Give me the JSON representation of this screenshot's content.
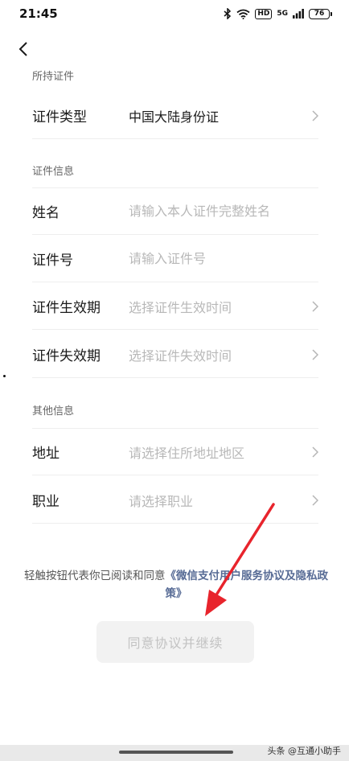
{
  "status_bar": {
    "time": "21:45",
    "network": "5G",
    "hd": "HD",
    "battery": "76"
  },
  "sections": {
    "held_id": "所持证件",
    "id_info": "证件信息",
    "other_info": "其他信息"
  },
  "rows": {
    "id_type": {
      "label": "证件类型",
      "value": "中国大陆身份证"
    },
    "name": {
      "label": "姓名",
      "placeholder": "请输入本人证件完整姓名"
    },
    "id_number": {
      "label": "证件号",
      "placeholder": "请输入证件号"
    },
    "valid_from": {
      "label": "证件生效期",
      "placeholder": "选择证件生效时间"
    },
    "valid_to": {
      "label": "证件失效期",
      "placeholder": "选择证件失效时间"
    },
    "address": {
      "label": "地址",
      "placeholder": "请选择住所地址地区"
    },
    "occupation": {
      "label": "职业",
      "placeholder": "请选择职业"
    }
  },
  "agreement": {
    "prefix": "轻触按钮代表你已阅读和同意",
    "link": "《微信支付用户服务协议及隐私政策》"
  },
  "button": {
    "label": "同意协议并继续"
  },
  "watermark": "头条 @互通小助手",
  "colors": {
    "link": "#576b95",
    "placeholder": "#b8b8b8",
    "annotation_arrow": "#e8242c"
  }
}
